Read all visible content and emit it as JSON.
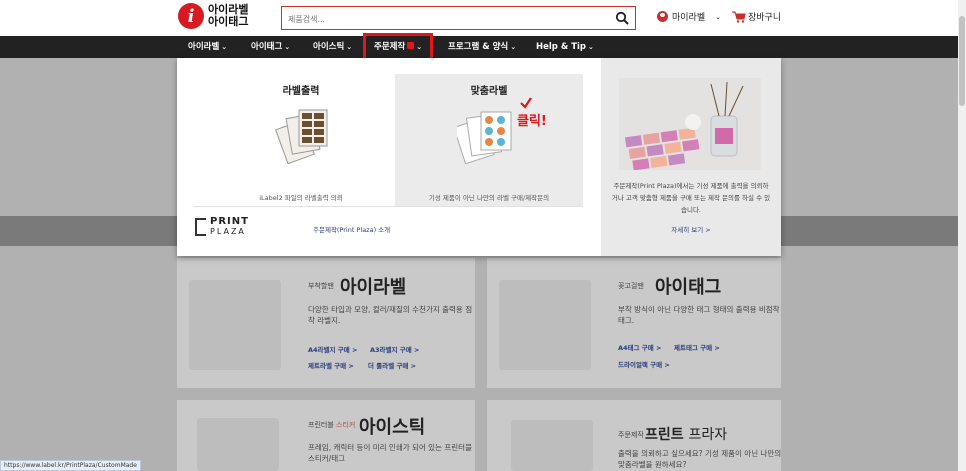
{
  "header": {
    "logo_line1": "아이라벨",
    "logo_line2": "아이태그",
    "search_placeholder": "제품검색...",
    "account_label": "마이라벨",
    "cart_label": "장바구니"
  },
  "nav": {
    "items": [
      {
        "label": "아이라벨"
      },
      {
        "label": "아이태그"
      },
      {
        "label": "아이스틱"
      },
      {
        "label": "주문제작",
        "active": true,
        "badge": "N"
      },
      {
        "label": "프로그램 & 양식"
      },
      {
        "label": "Help & Tip"
      }
    ]
  },
  "mega": {
    "option1_title": "라벨출력",
    "option1_caption": "iLabel2 파일의 라벨출력 의뢰",
    "option2_title": "맞춤라벨",
    "option2_caption": "기성 제품이 아닌 나만의 라벨 구매/제작문의",
    "click_note": "클릭!",
    "pp_logo_top": "PRINT",
    "pp_logo_bottom": "PLAZA",
    "pp_intro": "주문제작(Print Plaza) 소개",
    "side_desc": "주문제작(Print Plaza)에서는 기성 제품에 출력을 의뢰하거나 고객 맞춤형 제품을 구매 또는 제작 문의를 하실 수 있습니다.",
    "side_more": "자세히 보기 >"
  },
  "cards": {
    "c1_small": "부착할땐",
    "c1_big": "아이라벨",
    "c1_desc": "다양한 타입과 모양, 컬러/재질의 수천가지 출력용 점착 라벨지.",
    "c1_links": [
      "A4라벨지 구매 >",
      "A3라벨지 구매 >",
      "제트라벨 구매 >",
      "더 롤라벨 구매 >"
    ],
    "c2_small": "꽂고걸땐",
    "c2_big": "아이태그",
    "c2_desc": "부착 방식이 아닌 다양한 태그 형태의 출력용 비점착 태그.",
    "c2_links": [
      "A4태그 구매 >",
      "제트태그 구매 >",
      "드라이얼랙 구매 >"
    ],
    "c3_small_a": "프린터블",
    "c3_small_b": "스티커",
    "c3_big": "아이스틱",
    "c3_desc": "프레임, 캐릭터 등이 미리 인쇄가 되어 있는 프린터블 스티커/태그",
    "c4_small": "주문제작",
    "c4_big_a": "프린트",
    "c4_big_b": "프라자",
    "c4_desc": "출력을 의뢰하고 싶으세요? 기성 제품이 아닌 나만의 맞춤라벨을 원하세요?"
  },
  "status_url": "https://www.label.kr/PrintPlaza/CustomMade",
  "colors": {
    "brand_red": "#e2161b",
    "nav_bg": "#222222",
    "link_blue": "#2a3d7a"
  }
}
